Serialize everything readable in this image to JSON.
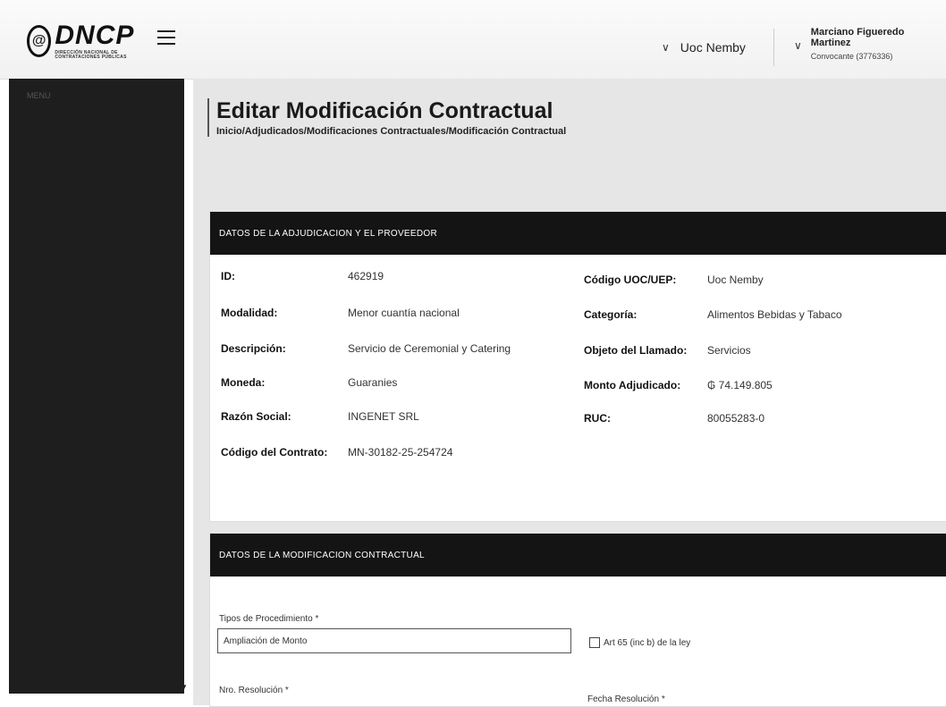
{
  "header": {
    "logo_text": "DNCP",
    "logo_subtitle": "DIRECCIÓN NACIONAL DE CONTRATACIONES PÚBLICAS",
    "uoc_selector": "Uoc Nemby",
    "user_name": "Marciano Figueredo Martinez",
    "user_role": "Convocante (3776336)"
  },
  "sidebar": {
    "label": "MENU"
  },
  "page": {
    "title": "Editar Modificación Contractual",
    "breadcrumb": "Inicio/Adjudicados/Modificaciones Contractuales/Modificación Contractual"
  },
  "adjudicacion": {
    "header": "DATOS DE LA ADJUDICACION Y EL PROVEEDOR",
    "left": [
      {
        "label": "ID:",
        "value": "462919"
      },
      {
        "label": "Modalidad:",
        "value": "Menor cuantía nacional"
      },
      {
        "label": "Descripción:",
        "value": "Servicio de Ceremonial y Catering"
      },
      {
        "label": "Moneda:",
        "value": "Guaranies"
      },
      {
        "label": "Razón Social:",
        "value": "INGENET SRL"
      },
      {
        "label": "Código del Contrato:",
        "value": "MN-30182-25-254724"
      }
    ],
    "right": [
      {
        "label": "Código UOC/UEP:",
        "value": "Uoc Nemby"
      },
      {
        "label": "Categoría:",
        "value": "Alimentos Bebidas y Tabaco"
      },
      {
        "label": "Objeto del Llamado:",
        "value": "Servicios"
      },
      {
        "label": "Monto Adjudicado:",
        "value": "₲ 74.149.805"
      },
      {
        "label": "RUC:",
        "value": "80055283-0"
      }
    ]
  },
  "modificacion": {
    "header": "DATOS DE LA MODIFICACION CONTRACTUAL",
    "tipo_label": "Tipos de Procedimiento *",
    "tipo_value": "Ampliación de Monto",
    "checkbox_label": "Art 65 (inc b) de la ley",
    "nro_label": "Nro. Resolución *",
    "fecha_label": "Fecha Resolución *"
  }
}
